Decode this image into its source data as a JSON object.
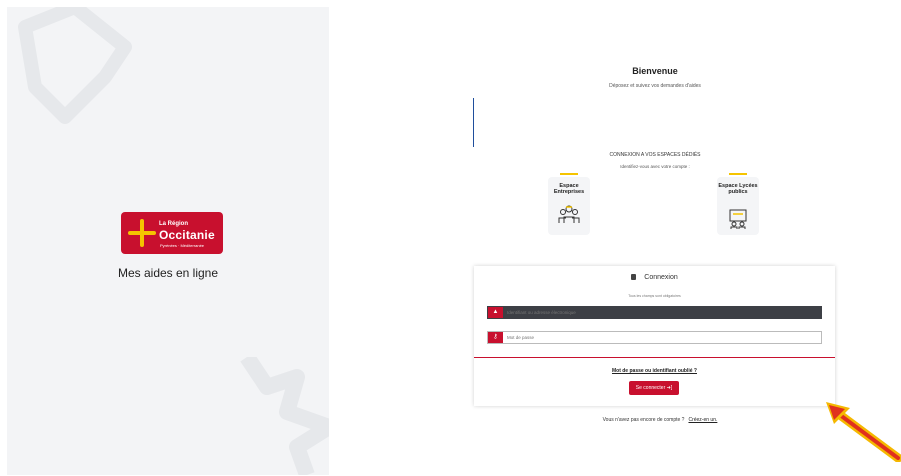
{
  "left": {
    "logo_small": "La Région",
    "logo_big": "Occitanie",
    "logo_sub": "Pyrénées · Méditerranée",
    "tagline": "Mes aides en ligne"
  },
  "welcome": {
    "title": "Bienvenue",
    "subtitle": "Déposez et suivez vos demandes d'aides"
  },
  "spaces": {
    "title": "CONNEXION A VOS ESPACES DÉDIÉS",
    "subtitle": "Identifiez-vous avec votre compte :",
    "cards": [
      {
        "label": "Espace Entreprises",
        "icon": "workers-icon"
      },
      {
        "label": "Espace Lycées publics",
        "icon": "school-icon"
      }
    ]
  },
  "login": {
    "header": "Connexion",
    "required_note": "Tous les champs sont obligatoires",
    "username_placeholder": "Identifiant ou adresse électronique",
    "password_placeholder": "Mot de passe",
    "forgot_link": "Mot de passe ou identifiant oublié ?",
    "submit_label": "Se connecter ➜]"
  },
  "signup": {
    "text": "Vous n'avez pas encore de compte ?",
    "link": "Créez-en un."
  },
  "colors": {
    "brand_red": "#c8102e",
    "accent_yellow": "#f5c400",
    "arrow_red": "#e0301e",
    "arrow_yellow": "#f5b800"
  }
}
